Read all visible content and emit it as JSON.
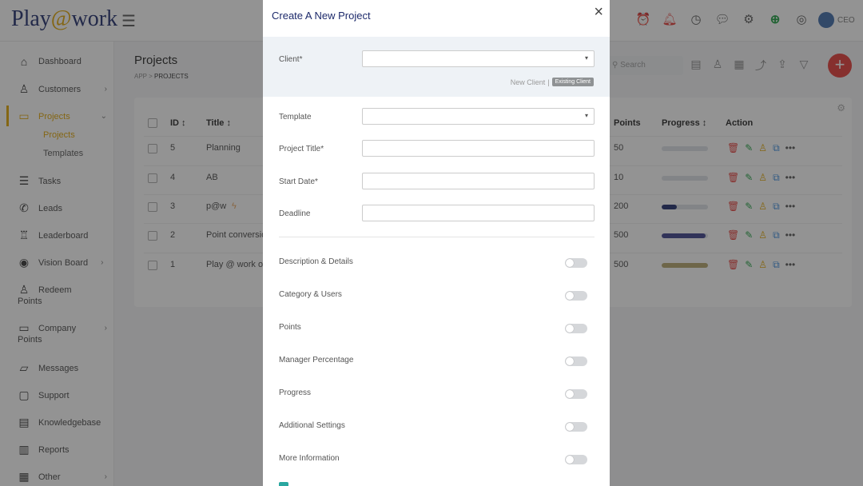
{
  "app": {
    "logo_text_1": "Play",
    "logo_at": "@",
    "logo_text_2": "work",
    "user_label": "CEO"
  },
  "sidebar": {
    "items": [
      {
        "label": "Dashboard",
        "icon": "home-icon"
      },
      {
        "label": "Customers",
        "icon": "customers-icon"
      },
      {
        "label": "Projects",
        "icon": "folder-icon"
      },
      {
        "label": "Tasks",
        "icon": "list-icon"
      },
      {
        "label": "Leads",
        "icon": "phone-icon"
      },
      {
        "label": "Leaderboard",
        "icon": "trophy-icon"
      },
      {
        "label": "Vision Board",
        "icon": "eye-icon"
      },
      {
        "label": "Redeem",
        "label2": "Points",
        "icon": "redeem-icon"
      },
      {
        "label": "Company",
        "label2": "Points",
        "icon": "folder-icon"
      },
      {
        "label": "Messages",
        "icon": "chat-icon"
      },
      {
        "label": "Support",
        "icon": "support-icon"
      },
      {
        "label": "Knowledgebase",
        "icon": "book-icon"
      },
      {
        "label": "Reports",
        "icon": "chart-icon"
      },
      {
        "label": "Other",
        "icon": "grid-icon"
      }
    ],
    "sub_items": [
      "Projects",
      "Templates"
    ]
  },
  "page": {
    "title": "Projects",
    "breadcrumb_root": "APP",
    "breadcrumb_sep": ">",
    "breadcrumb_current": "PROJECTS",
    "search_placeholder": "Search"
  },
  "table": {
    "headers": {
      "id": "ID ↕",
      "title": "Title ↕",
      "points": "Points",
      "progress": "Progress ↕",
      "action": "Action"
    },
    "rows": [
      {
        "id": "5",
        "title": "Planning",
        "points": "50",
        "progress": 0
      },
      {
        "id": "4",
        "title": "AB",
        "points": "10",
        "progress": 0
      },
      {
        "id": "3",
        "title": "p@w",
        "points": "200",
        "progress": 0.33
      },
      {
        "id": "2",
        "title": "Point conversio",
        "points": "500",
        "progress": 0.95
      },
      {
        "id": "1",
        "title": "Play @ work on",
        "points": "500",
        "progress": 1.0
      }
    ],
    "progress_colors": [
      "#dde1e6",
      "#dde1e6",
      "#1d2a6b",
      "#3b3f8a",
      "#b5a56a"
    ]
  },
  "modal": {
    "title": "Create A New Project",
    "client_label": "Client*",
    "new_client": "New Client",
    "link_sep": "|",
    "existing_client": "Existing Client",
    "template_label": "Template",
    "project_title_label": "Project Title*",
    "start_date_label": "Start Date*",
    "deadline_label": "Deadline",
    "sections": [
      "Description & Details",
      "Category & Users",
      "Points",
      "Manager Percentage",
      "Progress",
      "Additional Settings",
      "More Information"
    ]
  }
}
